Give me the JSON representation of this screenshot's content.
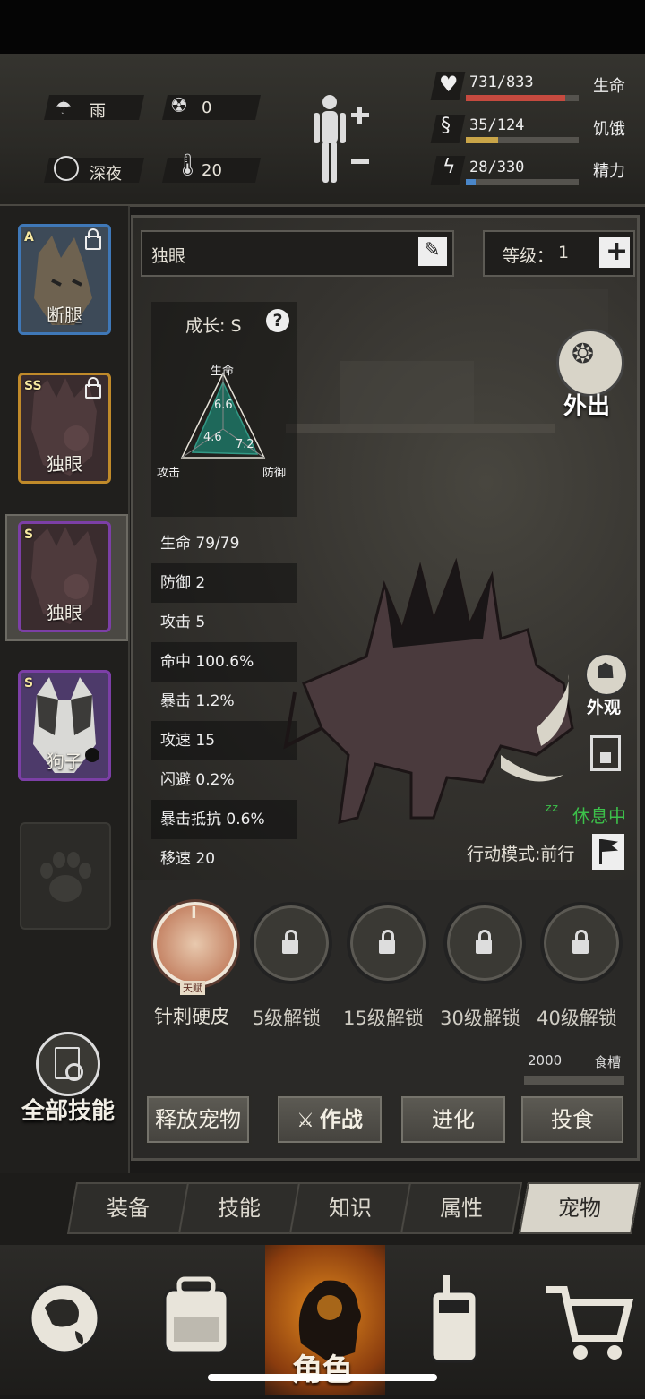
{
  "hud": {
    "weather": "雨",
    "radiation": "0",
    "time_of_day": "深夜",
    "temperature": "20",
    "life": {
      "value": "731/833",
      "label": "生命",
      "fraction": 0.878,
      "color": "#c64a3f"
    },
    "hunger": {
      "value": "35/124",
      "label": "饥饿",
      "fraction": 0.282,
      "color": "#c9a548"
    },
    "energy": {
      "value": "28/330",
      "label": "精力",
      "fraction": 0.085,
      "color": "#4a86c8"
    }
  },
  "pets": [
    {
      "grade": "A",
      "name": "断腿",
      "border": "#3f78b8"
    },
    {
      "grade": "SS",
      "name": "独眼",
      "border": "#c08a2a"
    },
    {
      "grade": "S",
      "name": "独眼",
      "border": "#7c3fa6"
    },
    {
      "grade": "S",
      "name": "狗子",
      "border": "#7c3fa6"
    }
  ],
  "pet_detail": {
    "name": "独眼",
    "level_label": "等级：",
    "level_value": "1",
    "growth": "成长: S",
    "radar": {
      "labels": {
        "top": "生命",
        "left": "攻击",
        "right": "防御"
      },
      "values": {
        "life": "6.6",
        "attack": "4.6",
        "defense": "7.2"
      }
    },
    "stats": [
      "生命 79/79",
      "防御 2",
      "攻击 5",
      "命中 100.6%",
      "暴击 1.2%",
      "攻速 15",
      "闪避 0.2%",
      "暴击抵抗 0.6%",
      "移速 20"
    ],
    "go_out": "外出",
    "appearance": "外观",
    "status": "休息中",
    "action_mode": "行动模式:前行",
    "talent_badge": "天赋",
    "skills": [
      {
        "label": "针刺硬皮"
      },
      {
        "label": "5级解锁"
      },
      {
        "label": "15级解锁"
      },
      {
        "label": "30级解锁"
      },
      {
        "label": "40级解锁"
      }
    ],
    "trough_value": "2000",
    "trough_label": "食槽",
    "all_skills": "全部技能",
    "buttons": {
      "release": "释放宠物",
      "battle": "作战",
      "evolve": "进化",
      "feed": "投食"
    }
  },
  "tabs": [
    "装备",
    "技能",
    "知识",
    "属性",
    "宠物"
  ],
  "bottom_nav": {
    "character": "角色"
  }
}
